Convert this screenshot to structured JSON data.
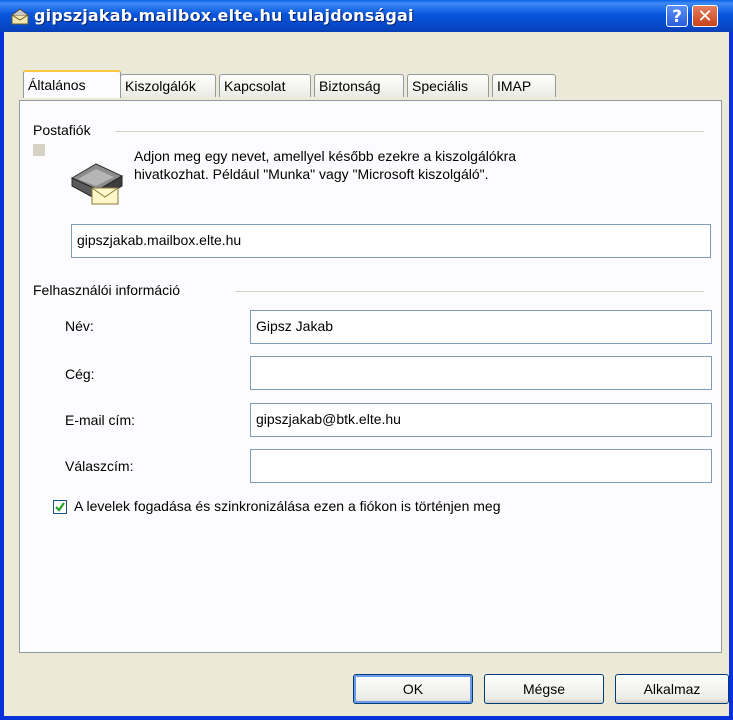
{
  "window": {
    "title": "gipszjakab.mailbox.elte.hu tulajdonságai",
    "help_label": "?",
    "close_label": "✕"
  },
  "tabs": [
    {
      "label": "Általános",
      "active": true
    },
    {
      "label": "Kiszolgálók"
    },
    {
      "label": "Kapcsolat"
    },
    {
      "label": "Biztonság"
    },
    {
      "label": "Speciális"
    },
    {
      "label": "IMAP"
    }
  ],
  "mail_account": {
    "group_label": "Postafiók",
    "description_line1": "Adjon meg egy nevet, amellyel később ezekre a kiszolgálókra",
    "description_line2": "hivatkozhat. Például \"Munka\" vagy \"Microsoft kiszolgáló\".",
    "account_name": "gipszjakab.mailbox.elte.hu"
  },
  "user_info": {
    "group_label": "Felhasználói információ",
    "name_label": "Név:",
    "name_value": "Gipsz Jakab",
    "company_label": "Cég:",
    "company_value": "",
    "email_label": "E-mail cím:",
    "email_value": "gipszjakab@btk.elte.hu",
    "reply_label": "Válaszcím:",
    "reply_value": ""
  },
  "sync_checkbox": {
    "label": "A levelek fogadása és szinkronizálása ezen a fiókon is történjen meg",
    "checked": true
  },
  "buttons": {
    "ok": "OK",
    "cancel": "Mégse",
    "apply": "Alkalmaz"
  }
}
